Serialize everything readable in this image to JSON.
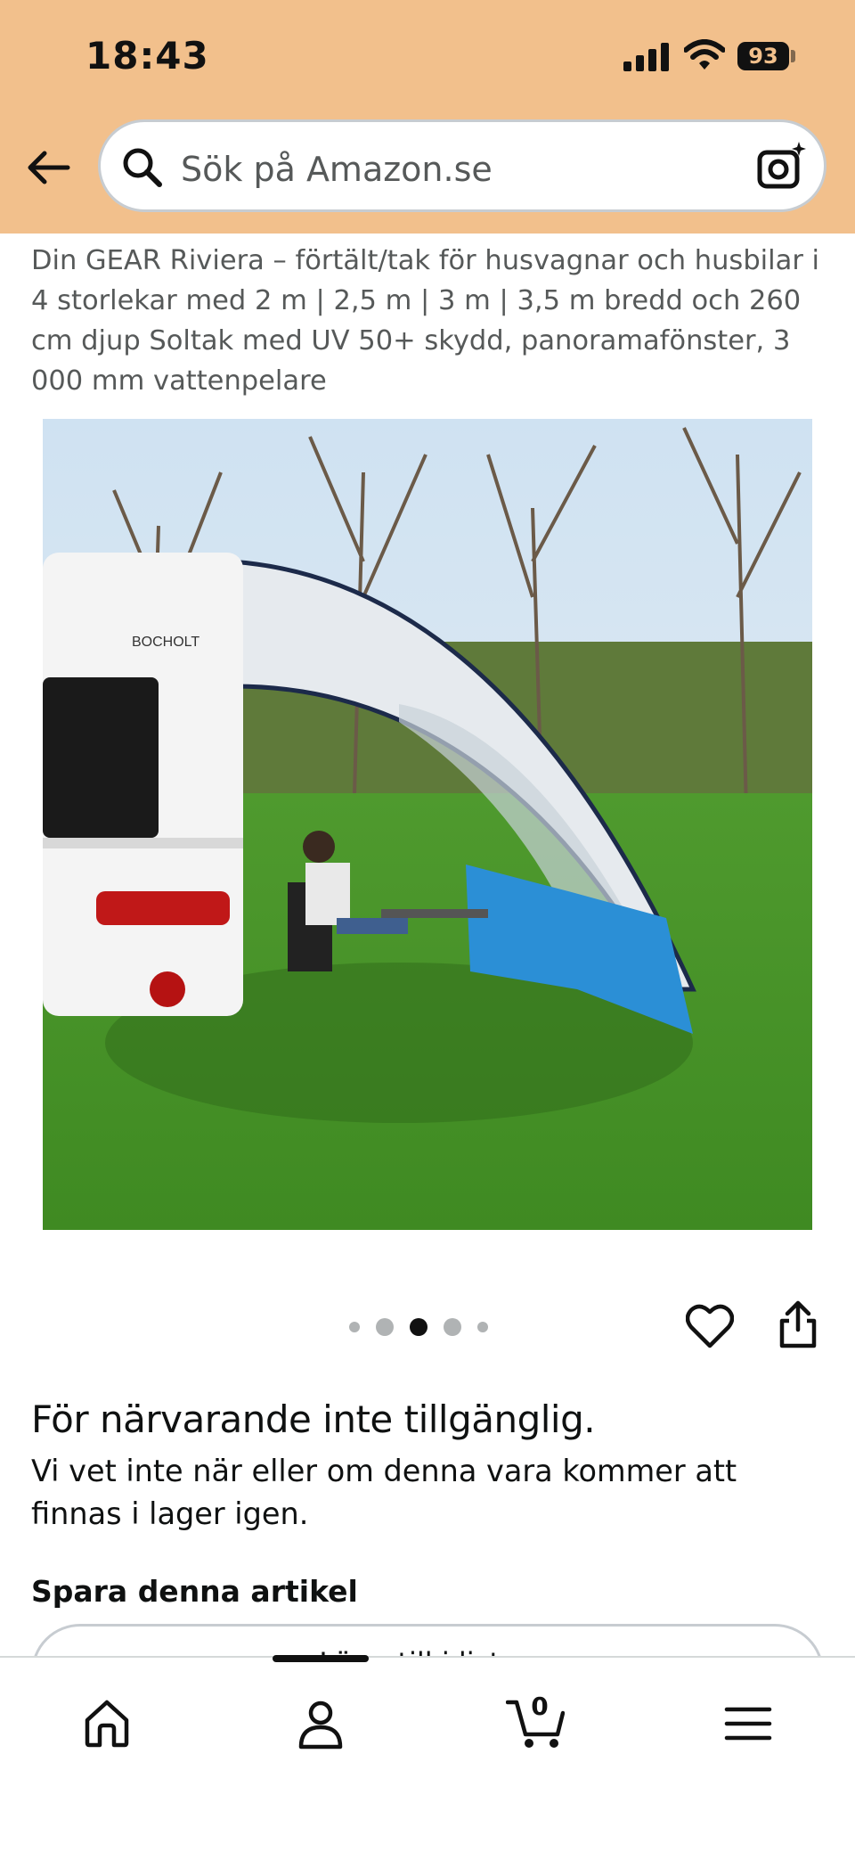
{
  "status_bar": {
    "time": "18:43",
    "battery": "93"
  },
  "search": {
    "placeholder": "Sök på Amazon.se"
  },
  "product": {
    "title": "Din GEAR Riviera – förtält/tak för husvagnar och husbilar i 4 storlekar med 2 m | 2,5 m | 3 m | 3,5 m bredd och 260 cm djup Soltak med UV 50+ skydd, panoramafönster, 3 000 mm vattenpelare",
    "image_icon": "product-photo",
    "image_text": "BOCHOLT",
    "image_count": 5,
    "active_image_index": 3
  },
  "availability": {
    "title": "För närvarande inte tillgänglig.",
    "description": "Vi vet inte när eller om denna vara kommer att finnas i lager igen."
  },
  "save": {
    "heading": "Spara denna artikel",
    "button_label": "Lägg till i listan"
  },
  "nav": {
    "cart_count": "0",
    "items": [
      "home-icon",
      "account-icon",
      "cart-icon",
      "menu-icon"
    ]
  },
  "colors": {
    "header_bg": "#f2c08c",
    "text": "#0f1111",
    "secondary_text": "#565959",
    "border": "#c7ccd1"
  }
}
